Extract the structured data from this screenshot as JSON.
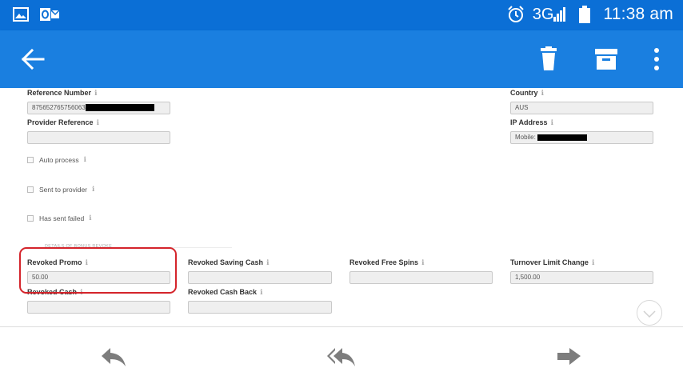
{
  "status_bar": {
    "network": "3G",
    "time": "11:38 am"
  },
  "details": {
    "reference_number": {
      "label": "Reference Number",
      "value": "875652765756063"
    },
    "provider_reference": {
      "label": "Provider Reference",
      "value": ""
    },
    "country": {
      "label": "Country",
      "value": "AUS"
    },
    "ip_address": {
      "label": "IP Address",
      "value": "Mobile:"
    },
    "checkboxes": [
      {
        "label": "Auto process"
      },
      {
        "label": "Sent to provider"
      },
      {
        "label": "Has sent failed"
      }
    ]
  },
  "bonus_revoke": {
    "section_caption": "DETAILS OF BONUS REVOKE",
    "revoked_promo": {
      "label": "Revoked Promo",
      "value": "50.00"
    },
    "revoked_saving_cash": {
      "label": "Revoked Saving Cash",
      "value": ""
    },
    "revoked_free_spins": {
      "label": "Revoked Free Spins",
      "value": ""
    },
    "turnover_limit_change": {
      "label": "Turnover Limit Change",
      "value": "1,500.00"
    },
    "revoked_cash": {
      "label": "Revoked Cash",
      "value": ""
    },
    "revoked_cash_back": {
      "label": "Revoked Cash Back",
      "value": ""
    }
  },
  "info_glyph": "ℹ",
  "colors": {
    "status_bar": "#0b6fd6",
    "app_bar": "#1a7fe0",
    "highlight": "#d4242b"
  }
}
